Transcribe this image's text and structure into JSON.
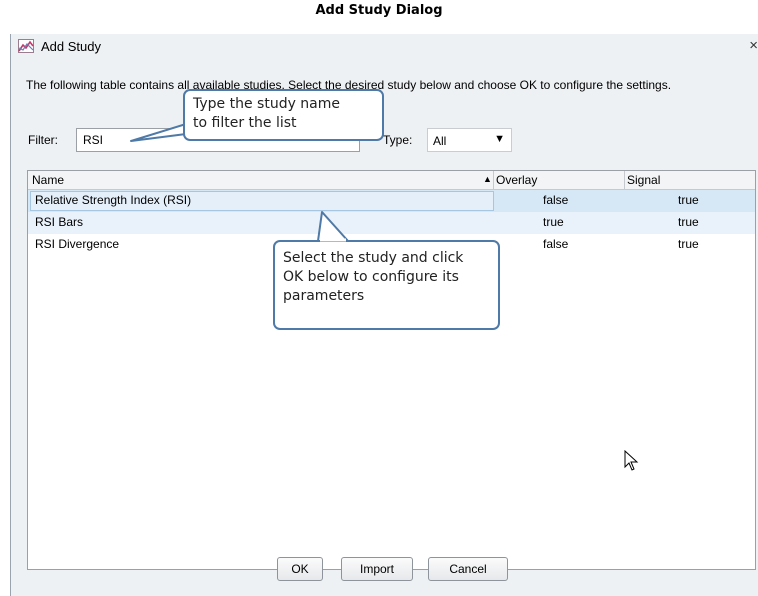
{
  "caption": "Add Study Dialog",
  "dialog": {
    "title": "Add Study",
    "close": "×",
    "description": "The following table contains all available studies. Select the desired study below and choose OK to configure the settings.",
    "filter": {
      "label": "Filter:",
      "value": "RSI"
    },
    "type": {
      "label": "Type:",
      "value": "All",
      "arrow": "▼"
    },
    "table": {
      "columns": [
        "Name",
        "Overlay",
        "Signal"
      ],
      "sort_indicator": "▲",
      "rows": [
        {
          "name": "Relative Strength Index (RSI)",
          "overlay": "false",
          "signal": "true"
        },
        {
          "name": "RSI Bars",
          "overlay": "true",
          "signal": "true"
        },
        {
          "name": "RSI Divergence",
          "overlay": "false",
          "signal": "true"
        }
      ]
    },
    "buttons": {
      "ok": "OK",
      "import": "Import",
      "cancel": "Cancel"
    }
  },
  "callouts": {
    "filter_tip_line1": "Type the study name",
    "filter_tip_line2": "to filter the list",
    "select_tip_line1": "Select the study and click",
    "select_tip_line2": "OK below to configure its",
    "select_tip_line3": "parameters"
  },
  "colors": {
    "accent": "#4f79a6",
    "selection": "#d6e7f6",
    "dialog_bg": "#eef1f4"
  }
}
